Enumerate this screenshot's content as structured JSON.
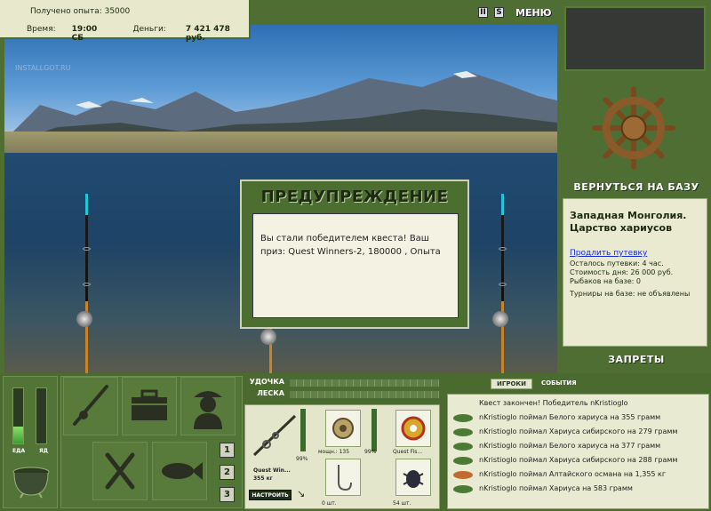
{
  "header": {
    "exp_label": "Получено опыта: 35000",
    "time_label": "Время:",
    "time_value": "19:00 СБ",
    "money_label": "Деньги:",
    "money_value": "7 421 478 руб.",
    "watermark": "INSTALLGOT.RU"
  },
  "top_controls": {
    "pause": "II",
    "sound": "S",
    "menu": "МЕНЮ"
  },
  "right_panel": {
    "return_button": "ВЕРНУТЬСЯ НА БАЗУ",
    "location_title": "Западная Монголия. Царство хариусов",
    "extend_link": "Продлить путевку",
    "lines": [
      "Осталось путевки: 4 час.",
      "Стоимость дня: 26 000 руб.",
      "Рыбаков на базе: 0"
    ],
    "tournaments": "Турниры на базе: не объявлены",
    "bans_button": "ЗАПРЕТЫ"
  },
  "dialog": {
    "title": "ПРЕДУПРЕЖДЕНИЕ",
    "message": "Вы стали победителем квеста! Ваш приз: Quest Winners-2, 180000 , Опыта"
  },
  "left_panel": {
    "food_label": "ЕДА",
    "food_level": 0.3,
    "poison_label": "ЯД",
    "poison_level": 0.0,
    "num_buttons": [
      "1",
      "2",
      "3"
    ]
  },
  "gear": {
    "rod_label": "УДОЧКА",
    "line_label": "ЛЕСКА",
    "rod_name": "Quest Win...",
    "rod_weight": "355 кг",
    "rod_pct": "99%",
    "reel_caption": "мощн.: 135",
    "reel_pct": "99%",
    "lure_caption": "Quest Fis...",
    "hook_count": "0 шт.",
    "bait_count": "54 шт.",
    "tune_button": "НАСТРОИТЬ"
  },
  "events": {
    "tabs": [
      "ИГРОКИ",
      "СОБЫТИЯ"
    ],
    "rows": [
      "Квест закончен! Победитель nKristioglo",
      "nKristioglo поймал Белого хариуса на 355 грамм",
      "nKristioglo поймал Хариуса сибирского на 279 грамм",
      "nKristioglo поймал Белого хариуса на 377 грамм",
      "nKristioglo поймал Хариуса сибирского на 288 грамм",
      "nKristioglo поймал Алтайского османа на 1,355 кг",
      "nKristioglo поймал Хариуса на 583 грамм"
    ]
  }
}
